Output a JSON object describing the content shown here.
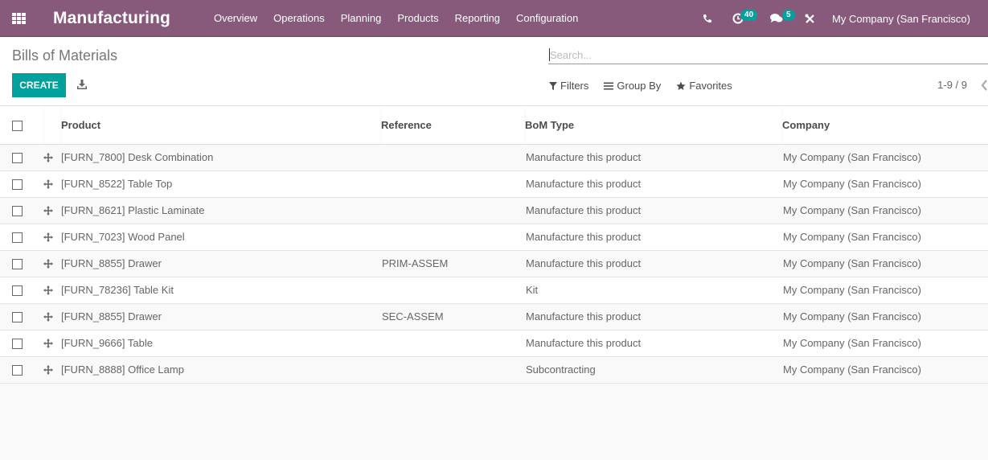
{
  "navbar": {
    "app_icon": "apps-grid-icon",
    "brand": "Manufacturing",
    "menu": [
      "Overview",
      "Operations",
      "Planning",
      "Products",
      "Reporting",
      "Configuration"
    ],
    "systray": {
      "phone_icon": "phone-icon",
      "activity_icon": "clock-icon",
      "activity_count": "40",
      "messages_icon": "chat-icon",
      "messages_count": "5",
      "debug_icon": "tools-icon",
      "company": "My Company (San Francisco)"
    },
    "brand_color": "#875a7b"
  },
  "control_panel": {
    "breadcrumb": "Bills of Materials",
    "create_label": "CREATE",
    "download_icon": "download-icon",
    "search_placeholder": "Search...",
    "search_value": "",
    "filters_label": "Filters",
    "group_by_label": "Group By",
    "favorites_label": "Favorites",
    "pager": "1-9 / 9",
    "accent_color": "#00a09d"
  },
  "table": {
    "columns": [
      "Product",
      "Reference",
      "BoM Type",
      "Company"
    ],
    "rows": [
      {
        "product": "[FURN_7800] Desk Combination",
        "reference": "",
        "bom_type": "Manufacture this product",
        "company": "My Company (San Francisco)"
      },
      {
        "product": "[FURN_8522] Table Top",
        "reference": "",
        "bom_type": "Manufacture this product",
        "company": "My Company (San Francisco)"
      },
      {
        "product": "[FURN_8621] Plastic Laminate",
        "reference": "",
        "bom_type": "Manufacture this product",
        "company": "My Company (San Francisco)"
      },
      {
        "product": "[FURN_7023] Wood Panel",
        "reference": "",
        "bom_type": "Manufacture this product",
        "company": "My Company (San Francisco)"
      },
      {
        "product": "[FURN_8855] Drawer",
        "reference": "PRIM-ASSEM",
        "bom_type": "Manufacture this product",
        "company": "My Company (San Francisco)"
      },
      {
        "product": "[FURN_78236] Table Kit",
        "reference": "",
        "bom_type": "Kit",
        "company": "My Company (San Francisco)"
      },
      {
        "product": "[FURN_8855] Drawer",
        "reference": "SEC-ASSEM",
        "bom_type": "Manufacture this product",
        "company": "My Company (San Francisco)"
      },
      {
        "product": "[FURN_9666] Table",
        "reference": "",
        "bom_type": "Manufacture this product",
        "company": "My Company (San Francisco)"
      },
      {
        "product": "[FURN_8888] Office Lamp",
        "reference": "",
        "bom_type": "Subcontracting",
        "company": "My Company (San Francisco)"
      }
    ]
  }
}
